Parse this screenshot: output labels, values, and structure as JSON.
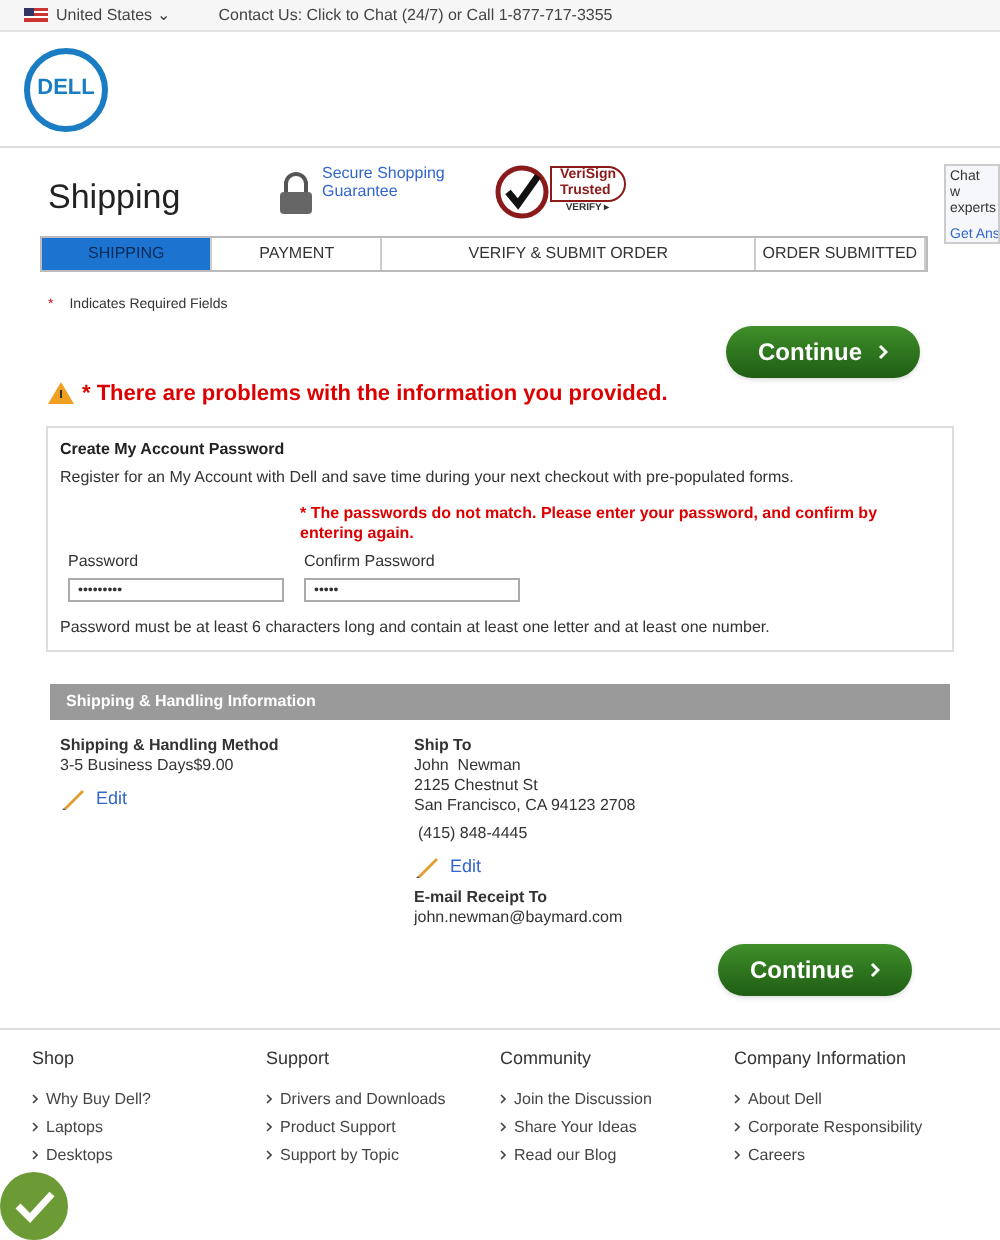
{
  "topbar": {
    "country": "United States",
    "caret": "⌄",
    "contact": "Contact Us: Click to Chat (24/7) or Call 1-877-717-3355"
  },
  "logo": {
    "text": "DELL"
  },
  "header": {
    "title": "Shipping",
    "secure": "Secure Shopping Guarantee",
    "verisign": {
      "line1": "VeriSign",
      "line2": "Trusted",
      "verify": "VERIFY ▸"
    }
  },
  "chat_box": {
    "text": "Chat w experts",
    "link": "Get Ans"
  },
  "steps": [
    {
      "label": "SHIPPING",
      "selected": true
    },
    {
      "label": "PAYMENT",
      "selected": false
    },
    {
      "label": "VERIFY & SUBMIT ORDER",
      "selected": false
    },
    {
      "label": "ORDER SUBMITTED",
      "selected": false
    }
  ],
  "required_mark": "*",
  "required_note": "Indicates Required Fields",
  "continue_button": "Continue",
  "error_banner": "* There are problems with the information you provided.",
  "account": {
    "title": "Create My Account Password",
    "description": "Register for an My Account with Dell and save time during your next checkout with pre-populated forms.",
    "error": "* The passwords do not match. Please enter your password, and confirm by entering again.",
    "fields": [
      {
        "label": "Password",
        "value": "•••••••••"
      },
      {
        "label": "Confirm Password",
        "value": "•••••"
      }
    ],
    "hint": "Password must be at least 6 characters long and contain at least one letter and at least one number."
  },
  "shipping": {
    "header": "Shipping & Handling Information",
    "method_title": "Shipping & Handling Method",
    "method": "3-5 Business Days$9.00",
    "edit": "Edit",
    "ship_to_title": "Ship To",
    "address": [
      "John  Newman",
      "2125 Chestnut St",
      "San Francisco, CA 94123 2708"
    ],
    "phone": "(415) 848-4445",
    "edit2": "Edit",
    "email_title": "E-mail Receipt To",
    "email": "john.newman@baymard.com"
  },
  "continue_button_2": "Continue",
  "footer": [
    {
      "title": "Shop",
      "links": [
        "Why Buy Dell?",
        "Laptops",
        "Desktops"
      ]
    },
    {
      "title": "Support",
      "links": [
        "Drivers and Downloads",
        "Product Support",
        "Support by Topic"
      ]
    },
    {
      "title": "Community",
      "links": [
        "Join the Discussion",
        "Share Your Ideas",
        "Read our Blog"
      ]
    },
    {
      "title": "Company Information",
      "links": [
        "About Dell",
        "Corporate Responsibility",
        "Careers"
      ]
    }
  ]
}
